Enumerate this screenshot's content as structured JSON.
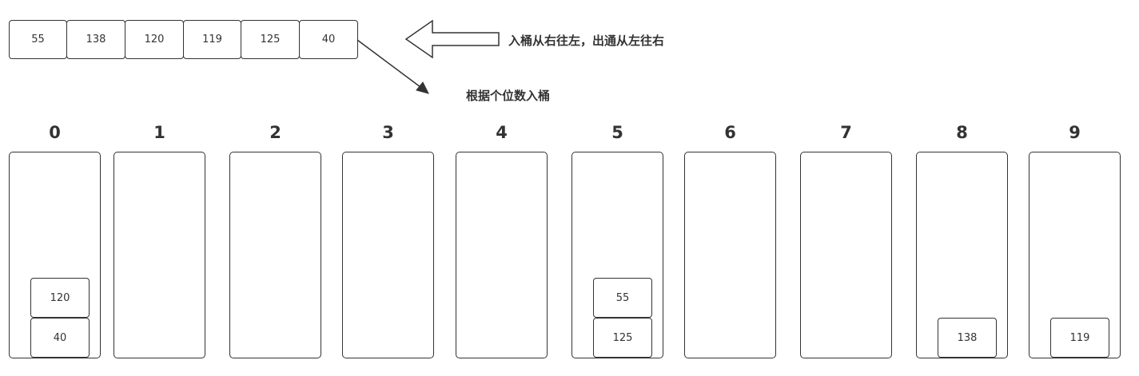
{
  "input_array": [
    "55",
    "138",
    "120",
    "119",
    "125",
    "40"
  ],
  "annotations": {
    "direction_note": "入桶从右往左，出通从左往右",
    "rule_note": "根据个位数入桶"
  },
  "buckets": [
    {
      "label": "0",
      "items": [
        "120",
        "40"
      ]
    },
    {
      "label": "1",
      "items": []
    },
    {
      "label": "2",
      "items": []
    },
    {
      "label": "3",
      "items": []
    },
    {
      "label": "4",
      "items": []
    },
    {
      "label": "5",
      "items": [
        "55",
        "125"
      ]
    },
    {
      "label": "6",
      "items": []
    },
    {
      "label": "7",
      "items": []
    },
    {
      "label": "8",
      "items": [
        "138"
      ]
    },
    {
      "label": "9",
      "items": [
        "119"
      ]
    }
  ]
}
